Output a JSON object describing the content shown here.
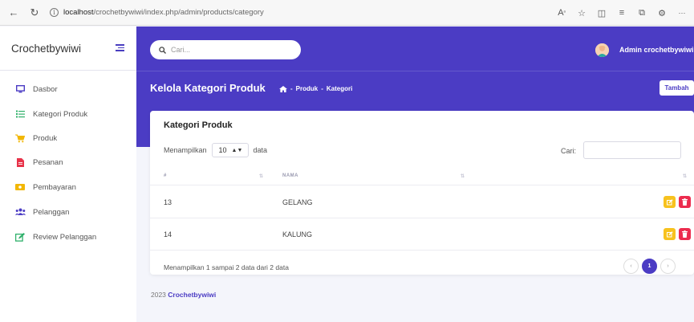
{
  "browser": {
    "url_host": "localhost",
    "url_path": "/crochetbywiwi/index.php/admin/products/category"
  },
  "sidebar": {
    "brand": "Crochetbywiwi",
    "items": [
      {
        "label": "Dasbor",
        "icon": "monitor-icon",
        "color": "#4b3cc4"
      },
      {
        "label": "Kategori Produk",
        "icon": "list-icon",
        "color": "#2fb06a"
      },
      {
        "label": "Produk",
        "icon": "cart-icon",
        "color": "#f2b705"
      },
      {
        "label": "Pesanan",
        "icon": "file-icon",
        "color": "#e8334a"
      },
      {
        "label": "Pembayaran",
        "icon": "money-icon",
        "color": "#f2b705"
      },
      {
        "label": "Pelanggan",
        "icon": "users-icon",
        "color": "#4b3cc4"
      },
      {
        "label": "Review Pelanggan",
        "icon": "edit-icon",
        "color": "#2fb06a"
      }
    ]
  },
  "header": {
    "search_placeholder": "Cari...",
    "admin_name": "Admin crochetbywiwi",
    "page_title": "Kelola Kategori Produk",
    "breadcrumb": [
      "Produk",
      "Kategori"
    ],
    "tambah_label": "Tambah"
  },
  "card": {
    "title": "Kategori Produk",
    "length_prefix": "Menampilkan",
    "length_value": "10",
    "length_suffix": "data",
    "search_label": "Cari:",
    "columns": [
      "#",
      "NAMA"
    ],
    "rows": [
      {
        "id": "13",
        "nama": "GELANG"
      },
      {
        "id": "14",
        "nama": "KALUNG"
      }
    ],
    "info": "Menampilkan 1 sampai 2 data dari 2 data",
    "current_page": "1"
  },
  "footer": {
    "year": "2023",
    "brand": "Crochetbywiwi"
  },
  "colors": {
    "primary": "#4b3cc4",
    "edit": "#f7c21e",
    "delete": "#ec2c4e"
  }
}
